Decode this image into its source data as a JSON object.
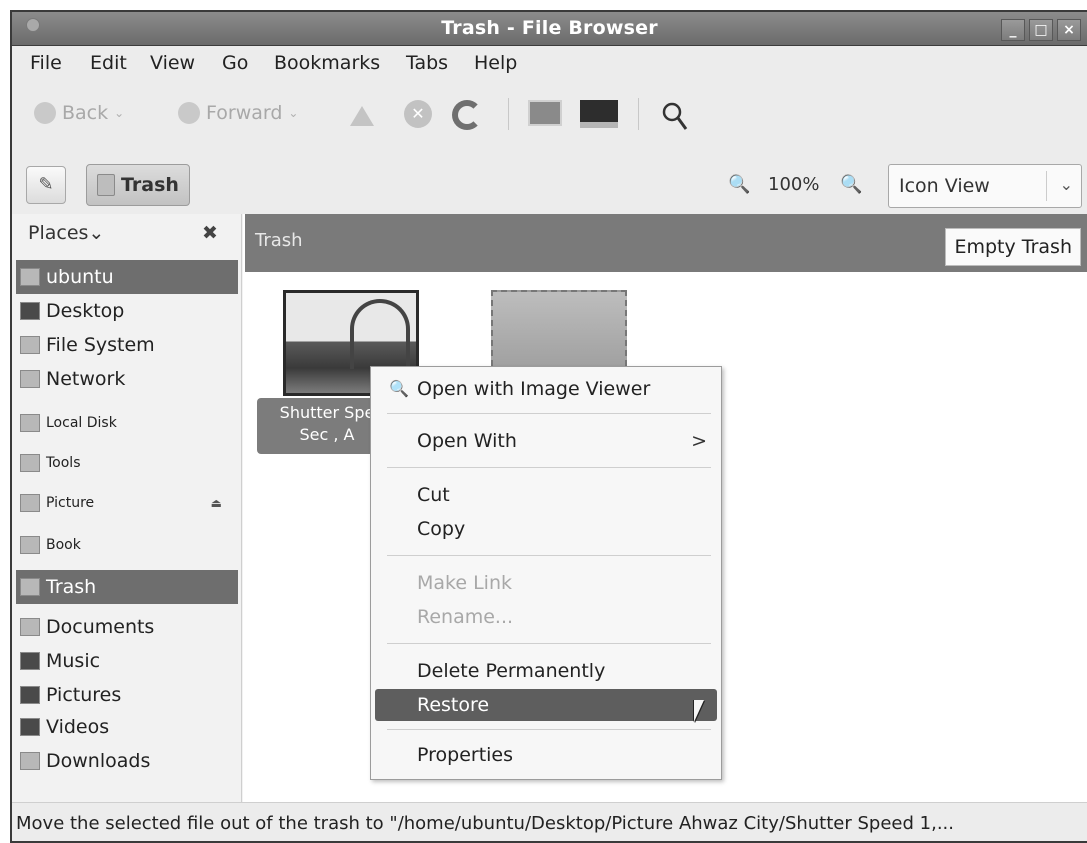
{
  "window": {
    "title": "Trash - File Browser",
    "controls": [
      "_",
      "□",
      "×"
    ]
  },
  "menubar": [
    "File",
    "Edit",
    "View",
    "Go",
    "Bookmarks",
    "Tabs",
    "Help"
  ],
  "toolbar": {
    "back_label": "Back",
    "forward_label": "Forward",
    "dropdown_glyph": "⌄",
    "stop_glyph": "✕"
  },
  "locbar": {
    "edit_glyph": "✎",
    "crumb_label": "Trash",
    "zoom_out_glyph": "🔍",
    "zoom_level": "100%",
    "zoom_in_glyph": "🔍",
    "view_mode": "Icon View",
    "view_chevron": "⌄"
  },
  "sidebar": {
    "header": "Places",
    "header_chevron": "⌄",
    "close_glyph": "✖",
    "eject_glyph": "⏏",
    "items": [
      {
        "label": "ubuntu"
      },
      {
        "label": "Desktop"
      },
      {
        "label": "File System"
      },
      {
        "label": "Network"
      },
      {
        "label": "Local Disk"
      },
      {
        "label": "Tools"
      },
      {
        "label": "Picture"
      },
      {
        "label": "Book"
      },
      {
        "label": "Trash"
      },
      {
        "label": "Documents"
      },
      {
        "label": "Music"
      },
      {
        "label": "Pictures"
      },
      {
        "label": "Videos"
      },
      {
        "label": "Downloads"
      }
    ]
  },
  "main": {
    "path_title": "Trash",
    "empty_trash_label": "Empty Trash",
    "file_label_line1": "Shutter Spe",
    "file_label_line2": "Sec , A"
  },
  "context_menu": {
    "items": [
      {
        "label": "Open with Image Viewer"
      },
      {
        "label": "Open With",
        "submenu_glyph": ">"
      },
      {
        "label": "Cut"
      },
      {
        "label": "Copy"
      },
      {
        "label": "Make Link"
      },
      {
        "label": "Rename..."
      },
      {
        "label": "Delete Permanently"
      },
      {
        "label": "Restore"
      },
      {
        "label": "Properties"
      }
    ],
    "open_icon_glyph": "🔍"
  },
  "statusbar": {
    "text": "Move the selected file out of the trash to \"/home/ubuntu/Desktop/Picture Ahwaz City/Shutter Speed 1,..."
  }
}
